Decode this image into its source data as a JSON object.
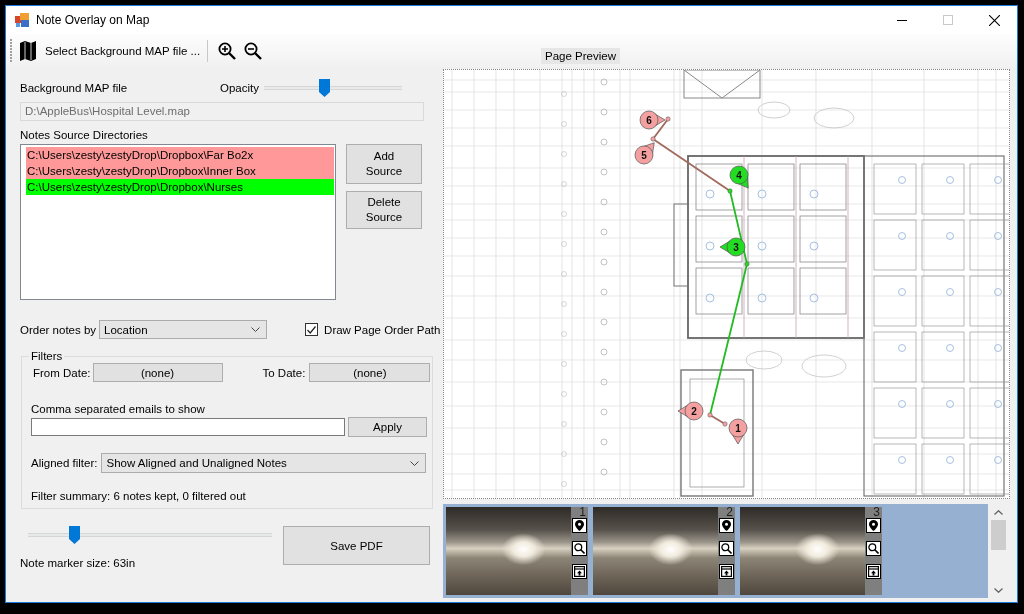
{
  "window": {
    "title": "Note Overlay on Map",
    "maximize_disabled": true
  },
  "toolbar": {
    "select_map_button": "Select Background MAP file ...",
    "page_preview": "Page Preview"
  },
  "map_file": {
    "label": "Background MAP file",
    "path": "D:\\AppleBus\\Hospital Level.map",
    "disabled": true
  },
  "opacity": {
    "label": "Opacity",
    "level": 0.44
  },
  "sources": {
    "label": "Notes Source Directories",
    "items": [
      {
        "path": "C:\\Users\\zesty\\zestyDrop\\Dropbox\\Far Bo2x",
        "color": "#ff9999"
      },
      {
        "path": "C:\\Users\\zesty\\zestyDrop\\Dropbox\\Inner Box",
        "color": "#ff9999"
      },
      {
        "path": "C:\\Users\\zesty\\zestyDrop\\Dropbox\\Nurses",
        "color": "#00ff00"
      }
    ],
    "buttons": [
      "Add Source",
      "Delete Source"
    ]
  },
  "order": {
    "label": "Order notes by",
    "value": "Location"
  },
  "draw_path": {
    "label": "Draw Page Order Path",
    "checked": true
  },
  "filters": {
    "title": "Filters",
    "from_date": {
      "label": "From Date:",
      "value": "(none)"
    },
    "to_date": {
      "label": "To Date:",
      "value": "(none)"
    },
    "emails_label": "Comma separated emails to show",
    "apply_button": "Apply",
    "aligned": {
      "label": "Aligned filter:",
      "value": "Show Aligned and Unaligned Notes"
    },
    "summary": "Filter summary: 6 notes kept, 0 filtered out"
  },
  "marker_size": {
    "level": 0.19,
    "label": "Note marker size: 63in"
  },
  "save_button": "Save PDF",
  "map": {
    "notes": [
      {
        "number": "1",
        "color": "#f4a0a0"
      },
      {
        "number": "2",
        "color": "#f4a0a0"
      },
      {
        "number": "3",
        "color": "#22dd22"
      },
      {
        "number": "4",
        "color": "#22dd22"
      },
      {
        "number": "5",
        "color": "#f4a0a0"
      },
      {
        "number": "6",
        "color": "#f4a0a0"
      }
    ],
    "path_segments": [
      {
        "color": "#a06a5e"
      },
      {
        "color": "#22bb22"
      },
      {
        "color": "#22bb22"
      },
      {
        "color": "#a06a5e"
      },
      {
        "color": "#a06a5e"
      }
    ]
  },
  "thumbnails": [
    {
      "number": "1"
    },
    {
      "number": "2"
    },
    {
      "number": "3"
    }
  ]
}
